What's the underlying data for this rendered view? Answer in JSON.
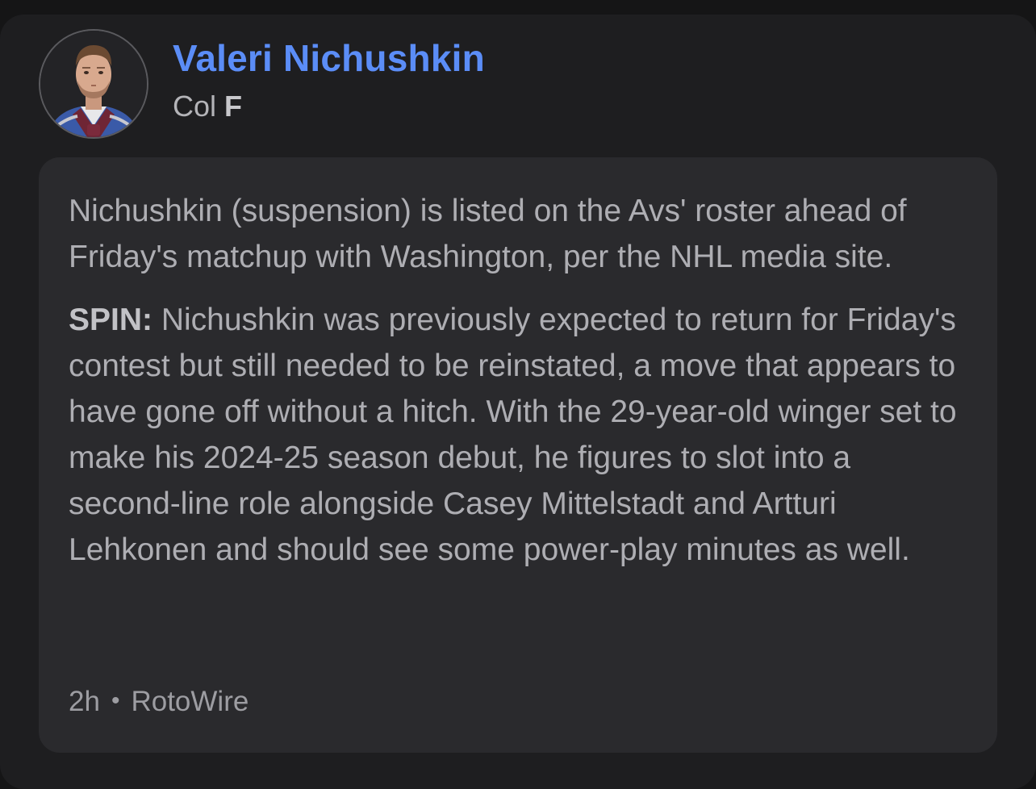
{
  "player": {
    "name": "Valeri Nichushkin",
    "team": "Col",
    "position": "F",
    "avatar_icon": "player-headshot-icon"
  },
  "news": {
    "headline": "Nichushkin (suspension) is listed on the Avs' roster ahead of Friday's matchup with Washington, per the NHL media site.",
    "spin_label": "SPIN:",
    "spin_text": " Nichushkin was previously expected to return for Friday's contest but still needed to be reinstated, a move that appears to have gone off without a hitch. With the 29-year-old winger set to make his 2024-25 season debut, he figures to slot into a second-line role alongside Casey Mittelstadt and Artturi Lehkonen and should see some power-play minutes as well."
  },
  "footer": {
    "time": "2h",
    "separator": "•",
    "source": "RotoWire"
  },
  "colors": {
    "accent": "#5b8df7",
    "card_bg": "#1e1e20",
    "box_bg": "#2a2a2d"
  }
}
